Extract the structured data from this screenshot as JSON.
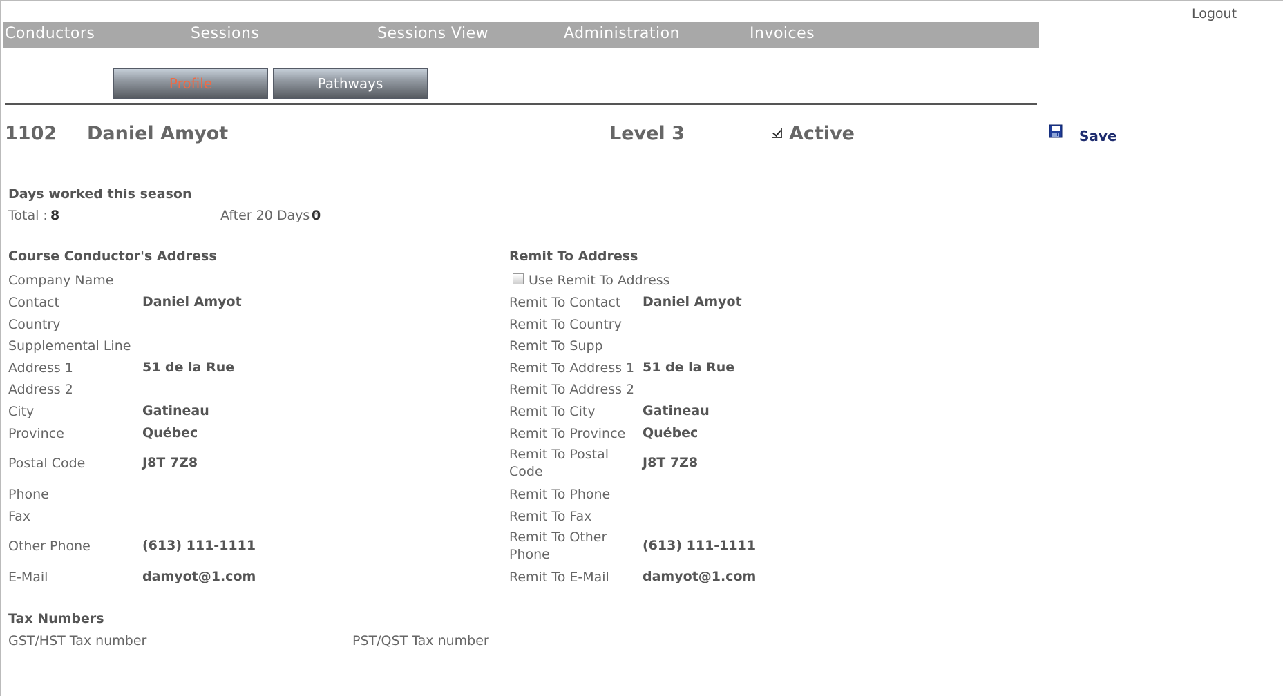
{
  "header": {
    "logout_label": "Logout",
    "nav": [
      "Conductors",
      "Sessions",
      "Sessions View",
      "Administration",
      "Invoices"
    ]
  },
  "tabs": {
    "profile": "Profile",
    "pathways": "Pathways"
  },
  "conductor": {
    "id": "1102",
    "name": "Daniel Amyot",
    "level": "Level 3",
    "active_label": "Active",
    "active_checked": true,
    "save_label": "Save"
  },
  "days_worked": {
    "title": "Days worked this season",
    "total_label": "Total :",
    "total_value": "8",
    "after_label": "After 20 Days :",
    "after_value": "0"
  },
  "address": {
    "title": "Course Conductor's Address",
    "rows": [
      {
        "label": "Company Name",
        "value": ""
      },
      {
        "label": "Contact",
        "value": "Daniel Amyot"
      },
      {
        "label": "Country",
        "value": ""
      },
      {
        "label": "Supplemental Line",
        "value": ""
      },
      {
        "label": "Address 1",
        "value": "51 de la Rue"
      },
      {
        "label": "Address 2",
        "value": ""
      },
      {
        "label": "City",
        "value": "Gatineau"
      },
      {
        "label": "Province",
        "value": "Québec"
      },
      {
        "label": "Postal Code",
        "value": "J8T 7Z8"
      },
      {
        "label": "Phone",
        "value": ""
      },
      {
        "label": "Fax",
        "value": ""
      },
      {
        "label": "Other Phone",
        "value": "(613) 111-1111"
      },
      {
        "label": "E-Mail",
        "value": "damyot@1.com"
      }
    ]
  },
  "remit": {
    "title": "Remit To Address",
    "use_remit_label": "Use Remit To Address",
    "use_remit_checked": false,
    "rows": [
      {
        "label": "Remit To Contact",
        "value": "Daniel Amyot"
      },
      {
        "label": "Remit To Country",
        "value": ""
      },
      {
        "label": "Remit To Supp",
        "value": ""
      },
      {
        "label": "Remit To Address 1",
        "value": "51 de la Rue"
      },
      {
        "label": "Remit To Address 2",
        "value": ""
      },
      {
        "label": "Remit To City",
        "value": "Gatineau"
      },
      {
        "label": "Remit To Province",
        "value": "Québec"
      },
      {
        "label": "Remit To Postal Code",
        "value": "J8T 7Z8"
      },
      {
        "label": "Remit To Phone",
        "value": ""
      },
      {
        "label": "Remit To Fax",
        "value": ""
      },
      {
        "label": "Remit To Other Phone",
        "value": "(613) 111-1111"
      },
      {
        "label": "Remit To E-Mail",
        "value": "damyot@1.com"
      }
    ]
  },
  "tax": {
    "title": "Tax Numbers",
    "gst_label": "GST/HST Tax number",
    "pst_label": "PST/QST Tax number"
  },
  "colors": {
    "nav_bg": "#a8a8a8",
    "active_tab_text": "#ee6a45",
    "save_text": "#1e2c6e"
  }
}
